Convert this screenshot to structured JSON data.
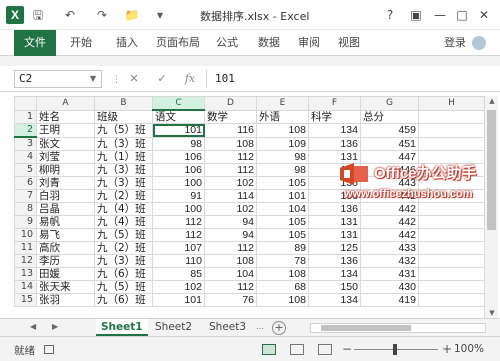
{
  "window": {
    "title": "数据排序.xlsx - Excel",
    "help": "?",
    "minimize": "—",
    "restore": "□",
    "close": "✕"
  },
  "quick_access": {
    "app_icon": "X",
    "save": "🖫",
    "undo": "↶",
    "redo": "↷",
    "folder": "📁",
    "more": "▾"
  },
  "ribbon_tabs": [
    "文件",
    "开始",
    "插入",
    "页面布局",
    "公式",
    "数据",
    "审阅",
    "视图"
  ],
  "account": {
    "login": "登录"
  },
  "formula_bar": {
    "name_box": "C2",
    "cancel": "✕",
    "enter": "✓",
    "fx": "fx",
    "value": "101"
  },
  "sheet": {
    "columns": [
      "A",
      "B",
      "C",
      "D",
      "E",
      "F",
      "G",
      "H"
    ],
    "rows": [
      {
        "n": "1",
        "cells": [
          "姓名",
          "班级",
          "语文",
          "数学",
          "外语",
          "科学",
          "总分",
          ""
        ]
      },
      {
        "n": "2",
        "cells": [
          "王明",
          "九（5）班",
          "101",
          "116",
          "108",
          "134",
          "459",
          ""
        ]
      },
      {
        "n": "3",
        "cells": [
          "张文",
          "九（3）班",
          "98",
          "108",
          "109",
          "136",
          "451",
          ""
        ]
      },
      {
        "n": "4",
        "cells": [
          "刘莹",
          "九（1）班",
          "106",
          "112",
          "98",
          "131",
          "447",
          ""
        ]
      },
      {
        "n": "5",
        "cells": [
          "柳明",
          "九（3）班",
          "106",
          "112",
          "98",
          "131",
          "446",
          ""
        ]
      },
      {
        "n": "6",
        "cells": [
          "刘青",
          "九（3）班",
          "100",
          "102",
          "105",
          "136",
          "443",
          ""
        ]
      },
      {
        "n": "7",
        "cells": [
          "白羽",
          "九（2）班",
          "91",
          "114",
          "101",
          "136",
          "442",
          ""
        ]
      },
      {
        "n": "8",
        "cells": [
          "吕晶",
          "九（4）班",
          "100",
          "102",
          "104",
          "136",
          "442",
          ""
        ]
      },
      {
        "n": "9",
        "cells": [
          "易帆",
          "九（4）班",
          "112",
          "94",
          "105",
          "131",
          "442",
          ""
        ]
      },
      {
        "n": "10",
        "cells": [
          "易飞",
          "九（5）班",
          "112",
          "94",
          "105",
          "131",
          "442",
          ""
        ]
      },
      {
        "n": "11",
        "cells": [
          "高欣",
          "九（2）班",
          "107",
          "112",
          "89",
          "125",
          "433",
          ""
        ]
      },
      {
        "n": "12",
        "cells": [
          "李历",
          "九（3）班",
          "110",
          "108",
          "78",
          "136",
          "432",
          ""
        ]
      },
      {
        "n": "13",
        "cells": [
          "田媛",
          "九（6）班",
          "85",
          "104",
          "108",
          "134",
          "431",
          ""
        ]
      },
      {
        "n": "14",
        "cells": [
          "张天来",
          "九（5）班",
          "102",
          "112",
          "68",
          "150",
          "430",
          ""
        ]
      },
      {
        "n": "15",
        "cells": [
          "张羽",
          "九（6）班",
          "101",
          "76",
          "108",
          "134",
          "419",
          ""
        ]
      }
    ],
    "numeric_columns": [
      2,
      3,
      4,
      5,
      6
    ],
    "active_cell": {
      "row": 1,
      "col": 2
    }
  },
  "sheet_tabs": {
    "prev": "◀",
    "next": "▶",
    "tabs": [
      "Sheet1",
      "Sheet2",
      "Sheet3"
    ],
    "active": "Sheet1",
    "add": "+"
  },
  "status_bar": {
    "status": "就绪",
    "zoom_minus": "−",
    "zoom_plus": "+",
    "zoom": "100%"
  },
  "watermark": {
    "brand": "Office办公助手",
    "url": "www.officezhushou.com"
  },
  "colors": {
    "excel_green": "#217346",
    "watermark_red": "#c0392b"
  }
}
